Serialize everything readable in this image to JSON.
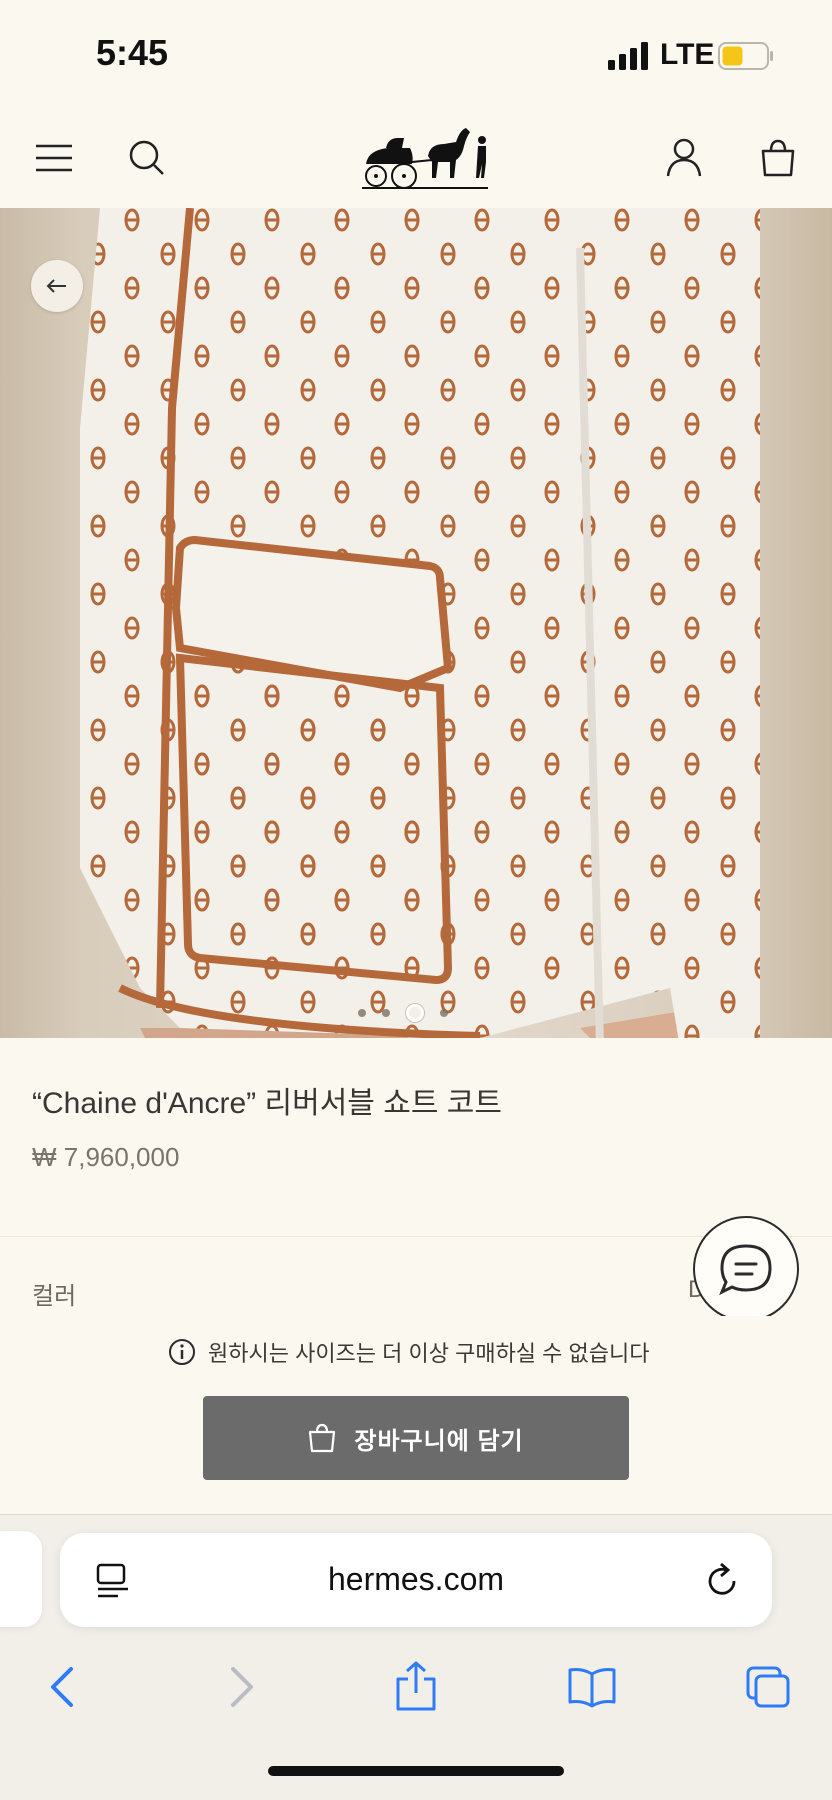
{
  "status_bar": {
    "time": "5:45",
    "network": "LTE",
    "battery_color": "#f5c518"
  },
  "header": {
    "menu_icon": "hamburger-menu-icon",
    "search_icon": "search-icon",
    "logo": "hermes-carriage-logo",
    "account_icon": "user-icon",
    "bag_icon": "shopping-bag-icon"
  },
  "gallery": {
    "back_icon": "arrow-left-icon",
    "image_count": 4,
    "active_index": 2,
    "fabric_color": "#f3f0ea",
    "accent_color": "#b5683a"
  },
  "product": {
    "title": "“Chaine d'Ancre” 리버서블 쇼트 코트",
    "price": "₩ 7,960,000",
    "color_label": "컬러",
    "color_value": "D"
  },
  "notice": {
    "text": "원하시는 사이즈는 더 이상 구매하실 수 없습니다",
    "icon": "info-icon"
  },
  "cta": {
    "label": "장바구니에 담기",
    "icon": "shopping-bag-icon",
    "bg_color": "#6b6b6b"
  },
  "chat": {
    "icon": "chat-bubble-icon"
  },
  "browser": {
    "url": "hermes.com",
    "reader_icon": "reader-mode-icon",
    "reload_icon": "reload-icon",
    "toolbar": [
      "back-icon",
      "forward-icon",
      "share-icon",
      "bookmarks-icon",
      "tabs-icon"
    ],
    "accent_color": "#2f7bf6"
  }
}
